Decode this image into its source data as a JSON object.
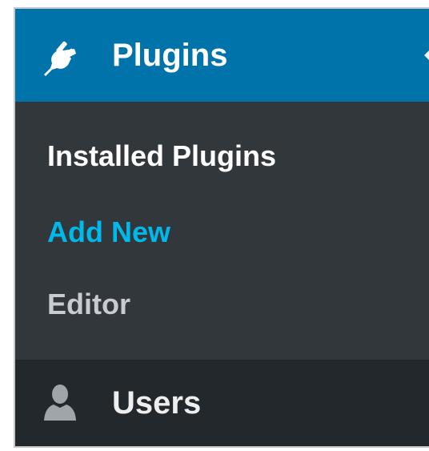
{
  "menu": {
    "plugins": {
      "label": "Plugins",
      "icon": "plug-icon",
      "active": true,
      "color": "#0073aa"
    },
    "submenu": [
      {
        "label": "Installed Plugins",
        "state": "current"
      },
      {
        "label": "Add New",
        "state": "hover"
      },
      {
        "label": "Editor",
        "state": "default"
      }
    ],
    "users": {
      "label": "Users",
      "icon": "user-icon"
    }
  },
  "colors": {
    "accent": "#0073aa",
    "submenu_bg": "#32373c",
    "menu_bg": "#23282d",
    "link": "#00b9eb"
  }
}
